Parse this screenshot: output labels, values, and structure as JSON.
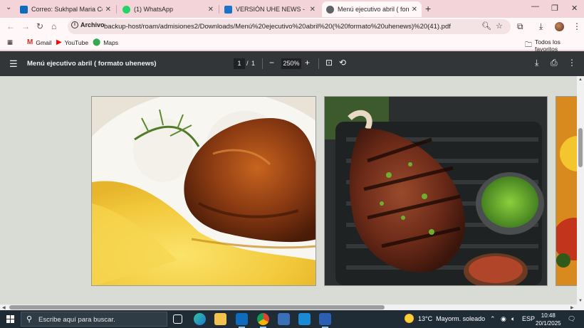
{
  "browser": {
    "tabs": [
      {
        "title": "Correo: Sukhpal Maria Cobo V",
        "icon": "outlook-icon",
        "color": "#0f6cbd"
      },
      {
        "title": "(1) WhatsApp",
        "icon": "whatsapp-icon",
        "color": "#25d366"
      },
      {
        "title": "VERSIÓN UHE NEWS - Sitio web",
        "icon": "sharepoint-icon",
        "color": "#1a73c9"
      },
      {
        "title": "Menú ejecutivo abril ( formato",
        "icon": "pdf-icon",
        "color": "#555555",
        "active": true
      }
    ],
    "omnibox": {
      "chip": "Archivo",
      "url": "backup-host/roam/admisiones2/Downloads/Menú%20ejecutivo%20abril%20(%20formato%20uhenews)%20(41).pdf"
    },
    "bookmarks": [
      {
        "label": "Gmail",
        "icon": "gmail-icon"
      },
      {
        "label": "YouTube",
        "icon": "youtube-icon"
      },
      {
        "label": "Maps",
        "icon": "maps-icon"
      }
    ],
    "all_bookmarks": "Todos los favoritos"
  },
  "pdf": {
    "title": "Menú ejecutivo abril ( formato uhenews)",
    "page_current": "1",
    "page_separator": "/",
    "page_total": "1",
    "zoom": "250%"
  },
  "taskbar": {
    "search_placeholder": "Escribe aquí para buscar.",
    "weather_temp": "13°C",
    "weather_desc": "Mayorm. soleado",
    "language": "ESP",
    "time": "10:48",
    "date": "20/1/2025"
  },
  "colors": {
    "tabstrip": "#f3d4d8",
    "pdf_toolbar": "#323639",
    "viewer_bg": "#d9dcd5",
    "taskbar": "#1f2b35"
  }
}
